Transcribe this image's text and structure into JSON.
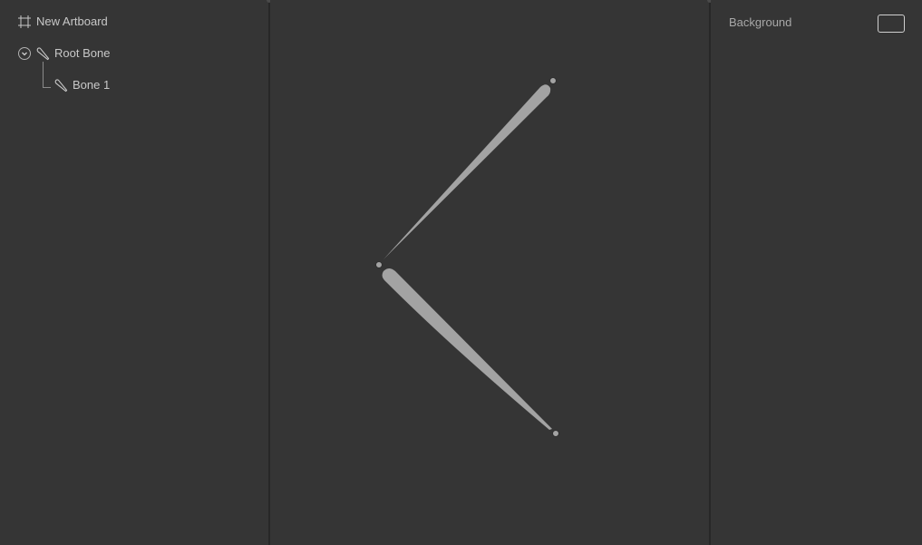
{
  "hierarchy": {
    "artboard": {
      "label": "New Artboard",
      "icon": "artboard-icon"
    },
    "root_bone": {
      "label": "Root Bone",
      "icon": "bone-icon",
      "expanded": true
    },
    "bone_1": {
      "label": "Bone 1",
      "icon": "bone-icon"
    }
  },
  "inspector": {
    "background_label": "Background",
    "background_color": "#353535"
  },
  "colors": {
    "panel_bg": "#353535",
    "divider": "#272727",
    "bone_fill": "#a3a3a3",
    "text": "#c8c8c8"
  }
}
